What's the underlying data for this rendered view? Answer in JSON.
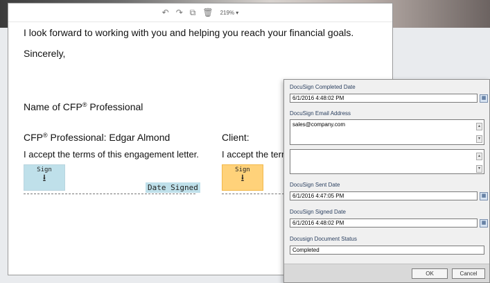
{
  "toolbar": {
    "zoom": "219%"
  },
  "document": {
    "line1": "I look forward to working with you and helping you reach your financial goals.",
    "line2": "Sincerely,",
    "name_prefix": "Name of CFP",
    "reg_mark": "®",
    "name_suffix": " Professional",
    "pro_prefix": "CFP",
    "pro_suffix": " Professional: Edgar Almond",
    "client": "Client:",
    "accept_left": "I accept the terms of this engagement letter.",
    "accept_right": "I accept the term",
    "sign_label": "Sign",
    "date_signed": "Date Signed"
  },
  "dialog": {
    "completed_date_label": "DocuSign Completed Date",
    "completed_date_value": "6/1/2016 4:48:02 PM",
    "email_label": "DocuSign Email Address",
    "email_value": "sales@company.com",
    "sent_date_label": "DocuSign Sent Date",
    "sent_date_value": "6/1/2016 4:47:05 PM",
    "signed_date_label": "DocuSign Signed Date",
    "signed_date_value": "6/1/2016 4:48:02 PM",
    "status_label": "Docusign Document Status",
    "status_value": "Completed",
    "ok": "OK",
    "cancel": "Cancel"
  }
}
